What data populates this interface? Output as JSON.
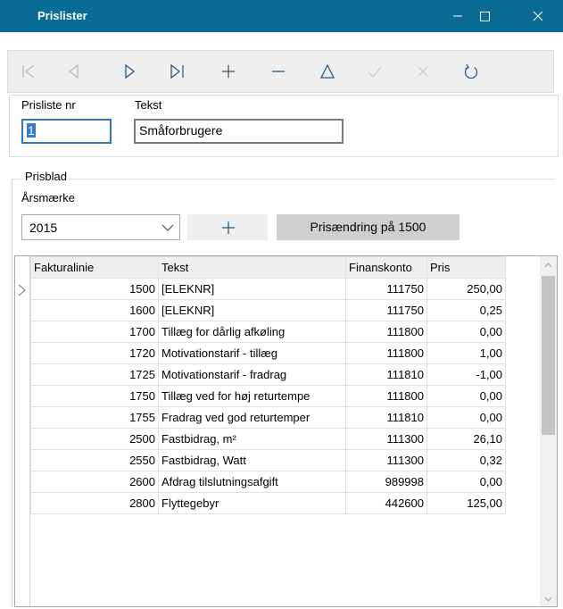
{
  "window": {
    "title": "Prislister"
  },
  "toolbar": {
    "buttons": [
      {
        "name": "first-record-icon"
      },
      {
        "name": "previous-record-icon"
      },
      {
        "name": "next-record-icon"
      },
      {
        "name": "last-record-icon"
      },
      {
        "name": "add-record-icon"
      },
      {
        "name": "delete-record-icon"
      },
      {
        "name": "edit-record-icon"
      },
      {
        "name": "save-record-icon"
      },
      {
        "name": "cancel-record-icon"
      },
      {
        "name": "refresh-icon"
      }
    ]
  },
  "header": {
    "prisliste_label": "Prisliste nr",
    "prisliste_value": "1",
    "tekst_label": "Tekst",
    "tekst_value": "Småforbrugere"
  },
  "prisblad": {
    "group_title": "Prisblad",
    "aarsmaerke_label": "Årsmærke",
    "aarsmaerke_value": "2015",
    "add_button_label": "+",
    "change_button_label": "Prisændring på 1500"
  },
  "grid": {
    "columns": [
      "Fakturalinie",
      "Tekst",
      "Finanskonto",
      "Pris"
    ],
    "rows": [
      [
        "1500",
        "[ELEKNR]",
        "111750",
        "250,00"
      ],
      [
        "1600",
        "[ELEKNR]",
        "111750",
        "0,25"
      ],
      [
        "1700",
        "Tillæg for dårlig afkøling",
        "111800",
        "0,00"
      ],
      [
        "1720",
        "Motivationstarif - tillæg",
        "111800",
        "1,00"
      ],
      [
        "1725",
        "Motivationstarif - fradrag",
        "111810",
        "-1,00"
      ],
      [
        "1750",
        "Tillæg ved for høj returtempe",
        "111800",
        "0,00"
      ],
      [
        "1755",
        "Fradrag ved god returtemper",
        "111810",
        "0,00"
      ],
      [
        "2500",
        "Fastbidrag, m²",
        "111300",
        "26,10"
      ],
      [
        "2550",
        "Fastbidrag, Watt",
        "111300",
        "0,32"
      ],
      [
        "2600",
        "Afdrag tilslutningsafgift",
        "989998",
        "0,00"
      ],
      [
        "2800",
        "Flyttegebyr",
        "442600",
        "125,00"
      ]
    ]
  },
  "colors": {
    "titlebar": "#0a6b94",
    "selection": "#3378d7"
  }
}
